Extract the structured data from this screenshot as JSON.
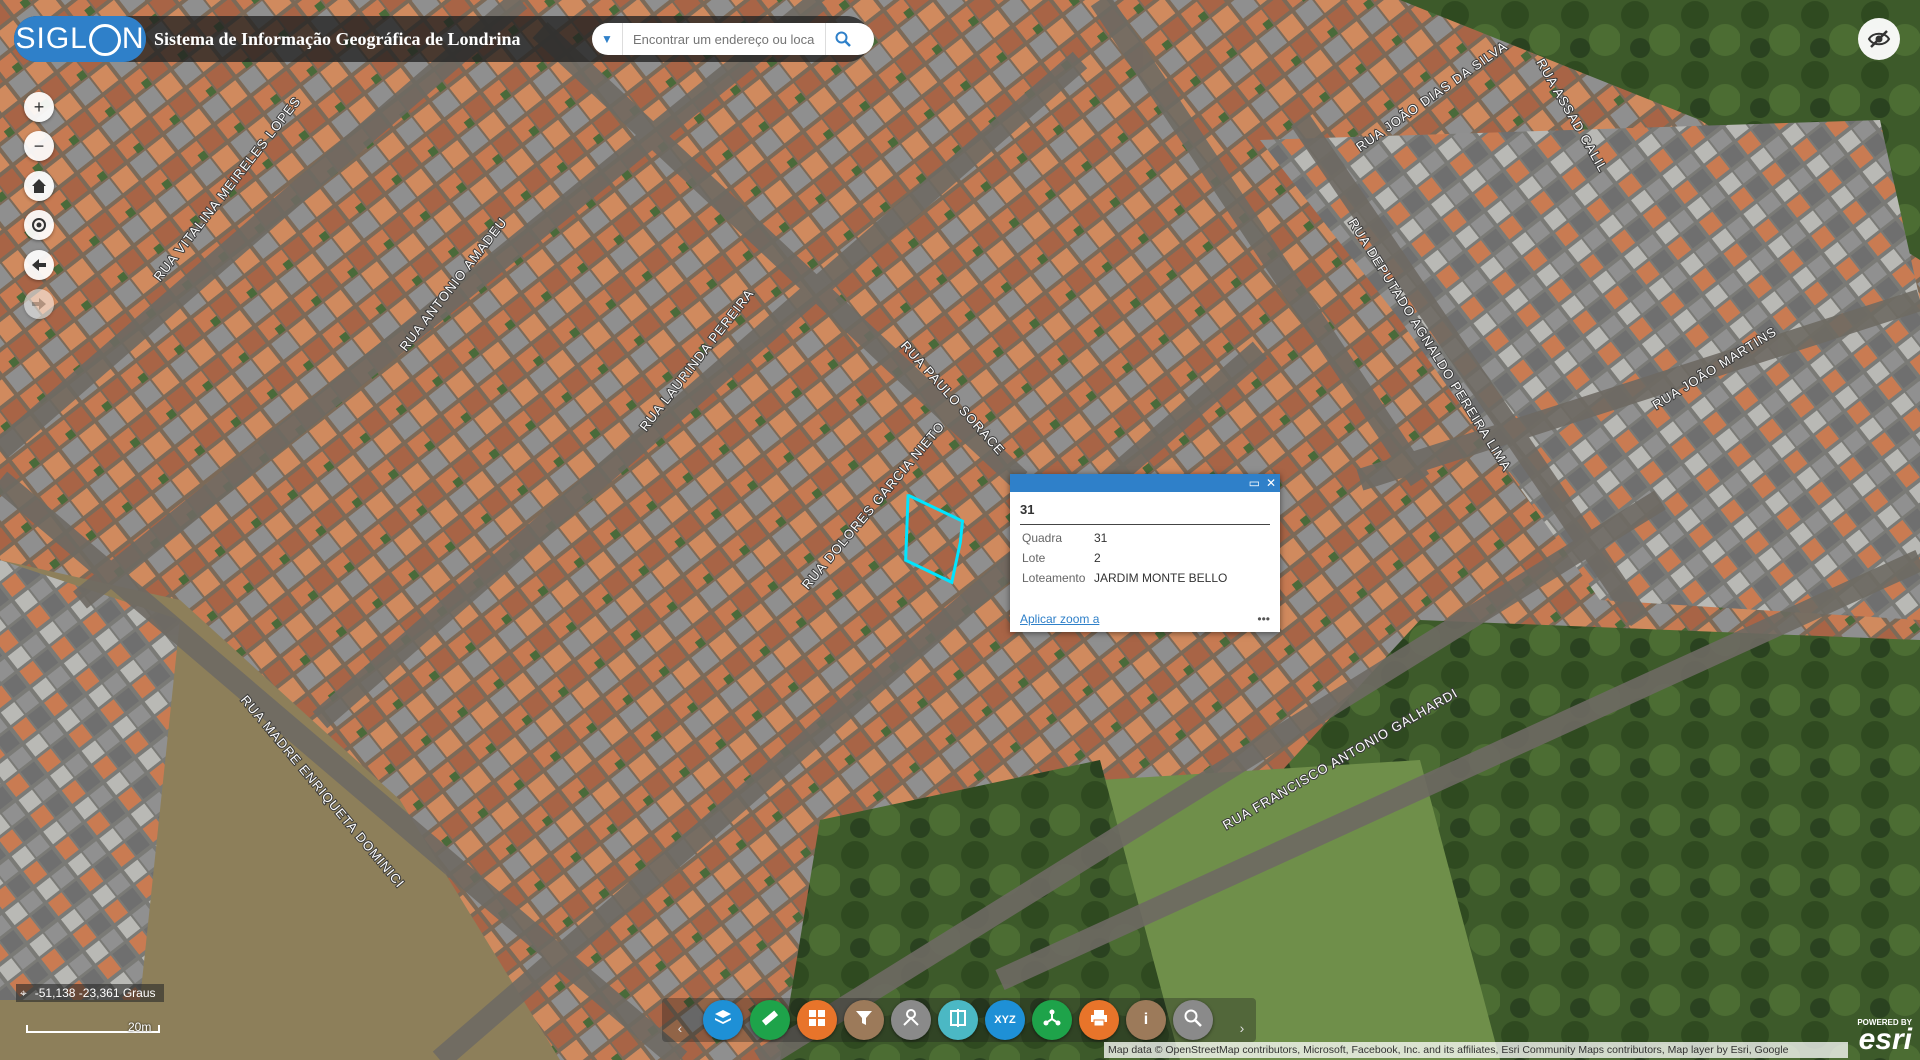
{
  "header": {
    "logo": "SIGLON",
    "logo_prefix": "SIGL",
    "logo_suffix": "N",
    "title": "Sistema de Informação Geográfica de Londrina",
    "search_placeholder": "Encontrar um endereço ou loca"
  },
  "streets": [
    "RUA VITALINA MEIRELES LOPES",
    "RUA ANTONIO AMADEU",
    "RUA LAURINDA PEREIRA",
    "RUA PAULO SORACE",
    "RUA DOLORES GARCIA NIETO",
    "RUA JOÃO DIAS DA SILVA",
    "RUA ASSAD CALIL",
    "RUA DEPUTADO AGNALDO PEREIRA LIMA",
    "RUA JOÃO MARTINS",
    "RUA MADRE ENRIQUETA DOMINICI",
    "RUA FRANCISCO ANTONIO GALHARDI"
  ],
  "popup": {
    "title": "31",
    "attributes": [
      {
        "key": "Quadra",
        "value": "31"
      },
      {
        "key": "Lote",
        "value": "2"
      },
      {
        "key": "Loteamento",
        "value": "JARDIM MONTE BELLO"
      }
    ],
    "zoom_link": "Aplicar zoom a",
    "more": "•••"
  },
  "coords": "-51,138 -23,361 Graus",
  "scale_label": "20m",
  "toolbar": {
    "buttons": [
      {
        "icon": "layers-icon",
        "glyph": "",
        "color": "#1e90d6"
      },
      {
        "icon": "measure-icon",
        "glyph": "",
        "color": "#1ea34a"
      },
      {
        "icon": "basemap-gallery-icon",
        "glyph": "",
        "color": "#e8742a"
      },
      {
        "icon": "filter-icon",
        "glyph": "",
        "color": "#9c7a5a"
      },
      {
        "icon": "directions-icon",
        "glyph": "",
        "color": "#8a8a8a"
      },
      {
        "icon": "swipe-icon",
        "glyph": "",
        "color": "#4bb8c4"
      },
      {
        "icon": "xyz-icon",
        "glyph": "XYZ",
        "color": "#1e90d6"
      },
      {
        "icon": "share-icon",
        "glyph": "",
        "color": "#1ea34a"
      },
      {
        "icon": "print-icon",
        "glyph": "",
        "color": "#e8742a"
      },
      {
        "icon": "info-icon",
        "glyph": "i",
        "color": "#9c7a5a"
      },
      {
        "icon": "query-icon",
        "glyph": "",
        "color": "#8a8a8a"
      }
    ]
  },
  "attribution": "Map data © OpenStreetMap contributors, Microsoft, Facebook, Inc. and its affiliates, Esri Community Maps contributors, Map layer by Esri, Google",
  "esri": {
    "powered_by": "POWERED BY",
    "brand": "esri"
  },
  "colors": {
    "accent": "#2f80c9",
    "parcel_highlight": "#00e5ff"
  }
}
